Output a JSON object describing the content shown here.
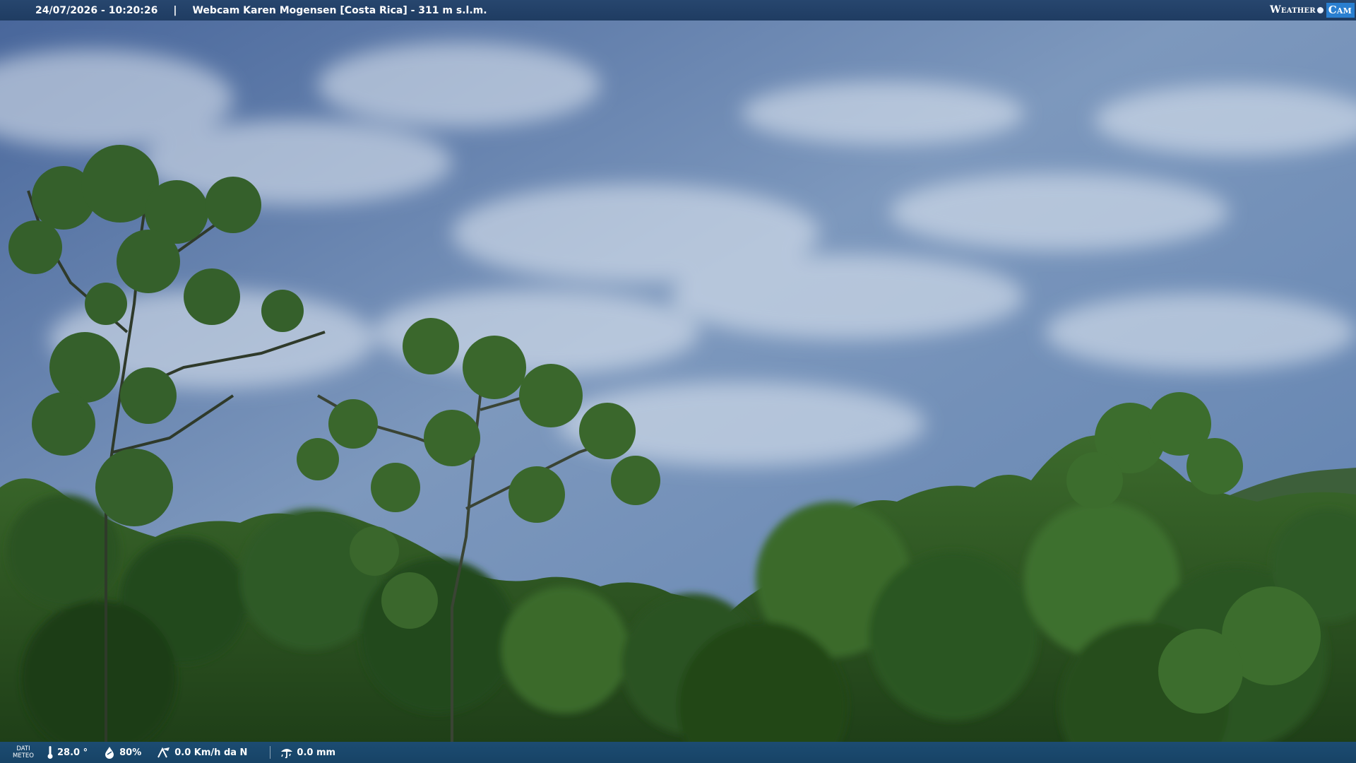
{
  "header": {
    "timestamp": "24/07/2026 - 10:20:26",
    "separator": "|",
    "title": "Webcam Karen Mogensen [Costa Rica] - 311 m s.l.m."
  },
  "brand": {
    "part1": "Weather",
    "part2": "Cam"
  },
  "footer": {
    "label_line1": "DATI",
    "label_line2": "METEO",
    "temperature": "28.0 °",
    "humidity": "80%",
    "wind": "0.0 Km/h da N",
    "rain": "0.0 mm"
  },
  "icons": [
    "thermometer-icon",
    "humidity-drop-icon",
    "wind-icon",
    "rain-gauge-icon",
    "weathercam-logo-icon"
  ],
  "colors": {
    "sky": "#5b7aa3",
    "foliage": "#2f5a25",
    "bar": "#1f3c62",
    "brand_accent": "#2a7fd0"
  }
}
